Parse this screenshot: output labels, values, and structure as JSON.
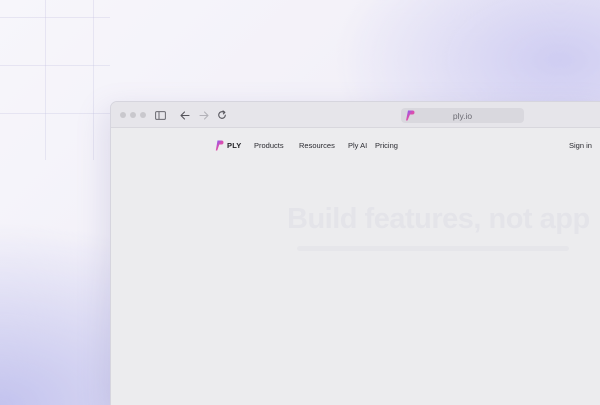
{
  "browser": {
    "url": "ply.io",
    "icons": [
      "traffic-lights",
      "sidebar-toggle-icon",
      "back-arrow-icon",
      "forward-arrow-icon",
      "reload-icon"
    ]
  },
  "site": {
    "brand": "PLY",
    "nav": {
      "products": "Products",
      "resources": "Resources",
      "ply_ai": "Ply AI",
      "pricing": "Pricing",
      "sign_in": "Sign in"
    },
    "hero": {
      "title": "Build features, not app"
    }
  },
  "colors": {
    "accent_gradient": [
      "#7b5cff",
      "#e64ca6",
      "#2fb8ff"
    ],
    "background_glow": "#c3c3ee"
  }
}
